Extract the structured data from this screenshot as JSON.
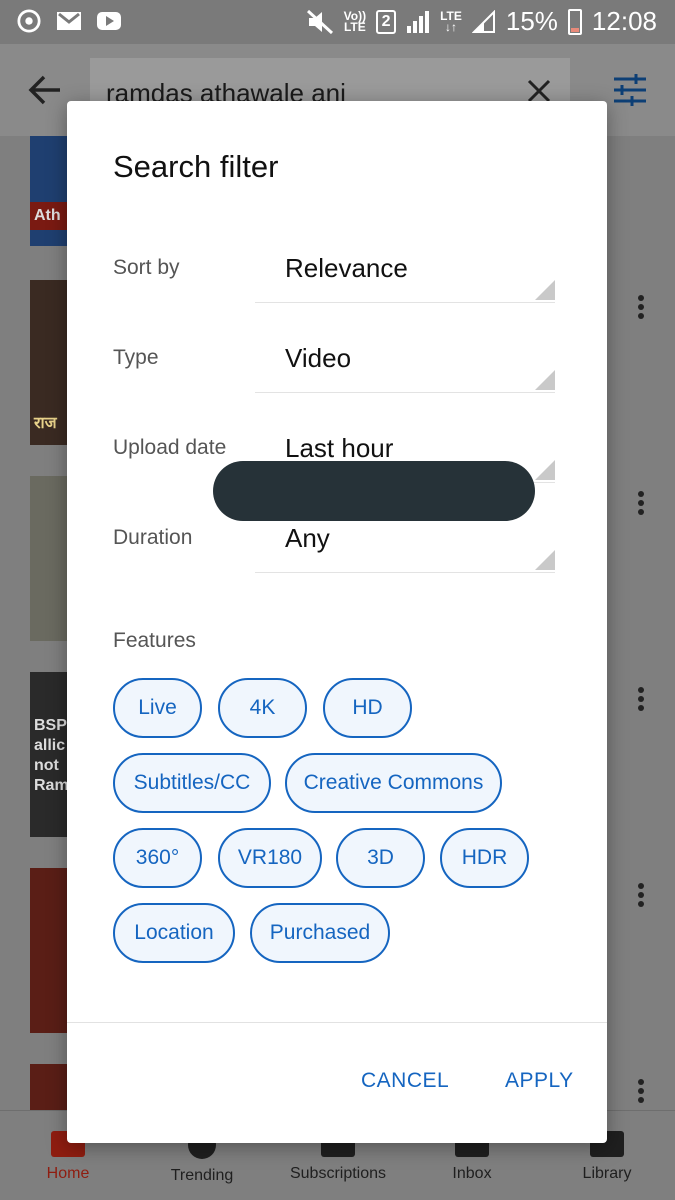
{
  "status_bar": {
    "volte_top": "Vo))",
    "volte_bottom": "LTE",
    "sim": "2",
    "lte_top": "LTE",
    "lte_bottom": "↓↑",
    "battery_percent": "15%",
    "time": "12:08"
  },
  "app_bar": {
    "search_query": "ramdas athawale ani"
  },
  "background_list": {
    "thumb_texts": [
      "Ath",
      "राज",
      "BSP allic not Ram"
    ]
  },
  "dialog": {
    "title": "Search filter",
    "rows": [
      {
        "label": "Sort by",
        "value": "Relevance"
      },
      {
        "label": "Type",
        "value": "Video"
      },
      {
        "label": "Upload date",
        "value": "Last hour"
      },
      {
        "label": "Duration",
        "value": "Any"
      }
    ],
    "features_label": "Features",
    "chips": [
      "Live",
      "4K",
      "HD",
      "Subtitles/CC",
      "Creative Commons",
      "360°",
      "VR180",
      "3D",
      "HDR",
      "Location",
      "Purchased"
    ],
    "cancel_label": "CANCEL",
    "apply_label": "APPLY"
  },
  "bottom_nav": {
    "items": [
      {
        "label": "Home",
        "active": true
      },
      {
        "label": "Trending"
      },
      {
        "label": "Subscriptions"
      },
      {
        "label": "Inbox"
      },
      {
        "label": "Library"
      }
    ]
  },
  "colors": {
    "accent": "#1565c0",
    "chip_bg": "#f0f6fd",
    "scrim": "#7f7f7f",
    "home_active": "#8f1d10",
    "redaction": "#263238"
  }
}
